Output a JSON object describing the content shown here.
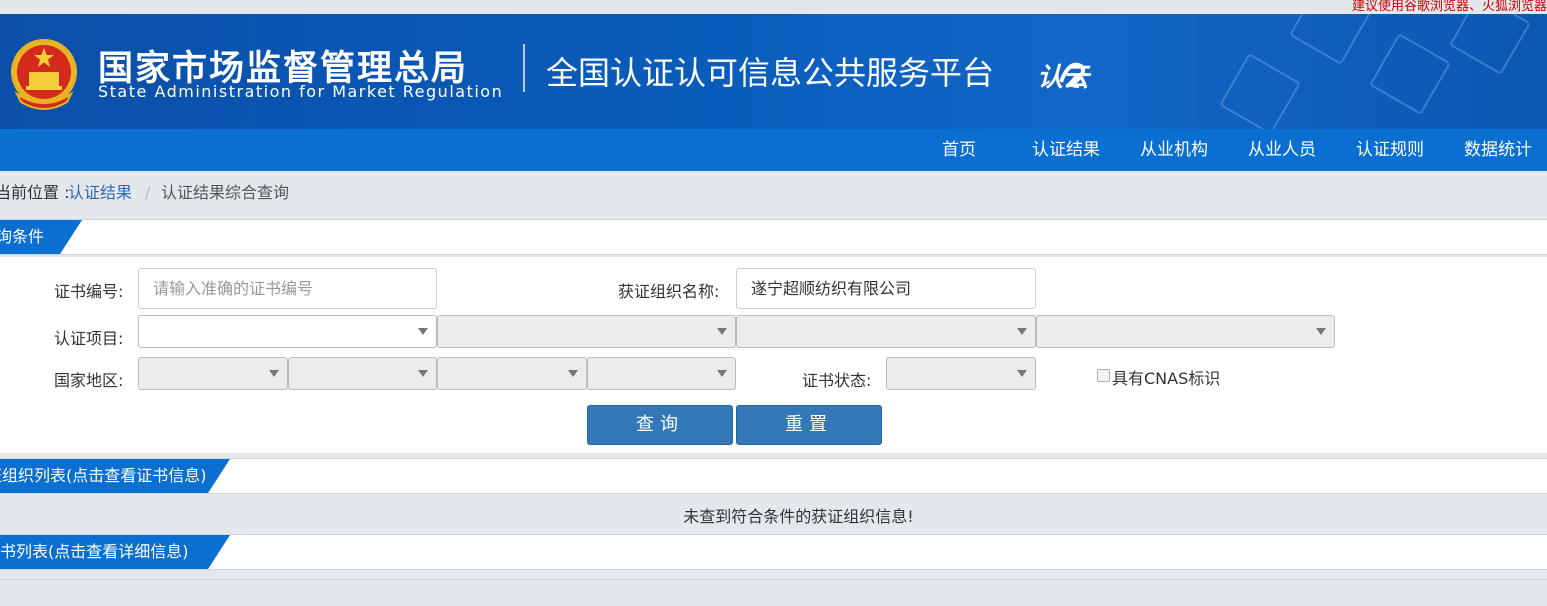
{
  "topbar": {
    "browser_tip": "建议使用谷歌浏览器、火狐浏览器"
  },
  "header": {
    "agency_cn": "国家市场监督管理总局",
    "agency_en": "State Administration  for  Market Regulation",
    "platform_title": "全国认证认可信息公共服务平台",
    "cloud_logo_text": "认云"
  },
  "nav": {
    "items": [
      {
        "label": "首页"
      },
      {
        "label": "认证结果"
      },
      {
        "label": "从业机构"
      },
      {
        "label": "从业人员"
      },
      {
        "label": "认证规则"
      },
      {
        "label": "数据统计"
      }
    ]
  },
  "breadcrumb": {
    "label": "当前位置 :",
    "link": "认证结果",
    "separator": "/",
    "current": "认证结果综合查询"
  },
  "query_section": {
    "title": "查询条件"
  },
  "form": {
    "cert_no_label": "证书编号:",
    "cert_no_placeholder": "请输入准确的证书编号",
    "cert_no_value": "",
    "org_name_label": "获证组织名称:",
    "org_name_value": "遂宁超顺纺织有限公司",
    "cert_project_label": "认证项目:",
    "region_label": "国家地区:",
    "cert_status_label": "证书状态:",
    "cnas_label": "具有CNAS标识",
    "cnas_checked": false,
    "search_button": "查询",
    "reset_button": "重置"
  },
  "org_list": {
    "title": "获证组织列表(点击查看证书信息)",
    "empty_message": "未查到符合条件的获证组织信息!"
  },
  "cert_list": {
    "title": "证书列表(点击查看详细信息)"
  },
  "colors": {
    "header_blue": "#0b4fa8",
    "nav_blue": "#0a6fd0",
    "button_blue": "#3478b8",
    "link_blue": "#2a6ab8",
    "tip_red": "#cc0000"
  }
}
